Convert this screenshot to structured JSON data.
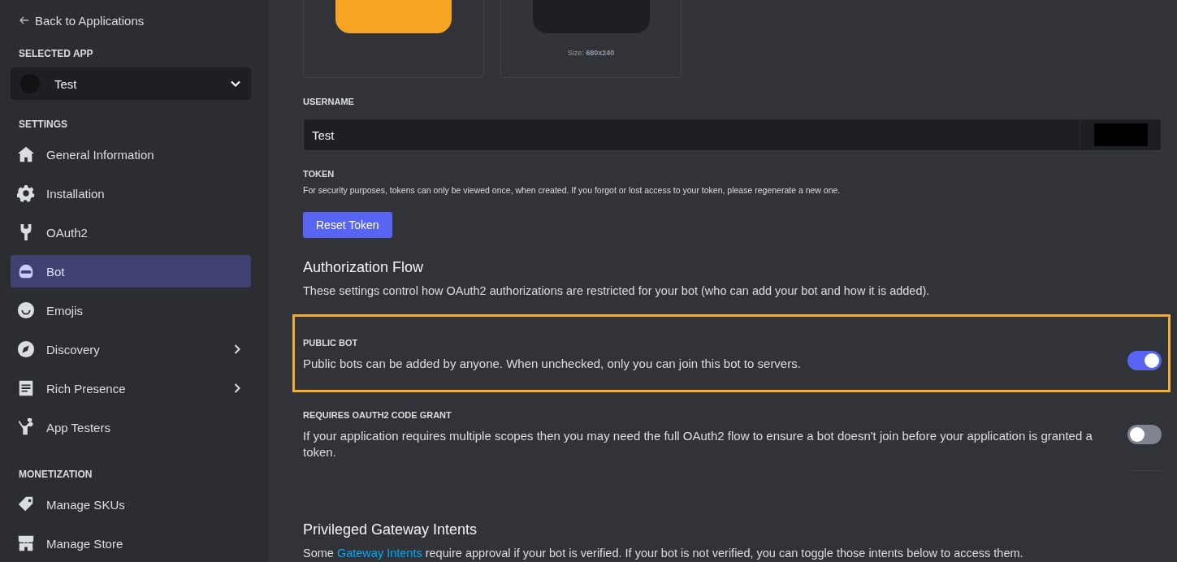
{
  "sidebar": {
    "back_link": "Back to Applications",
    "selected_app_label": "SELECTED APP",
    "selected_app": "Test",
    "sections": [
      {
        "title": "SETTINGS",
        "items": [
          {
            "label": "General Information",
            "selected": false,
            "has_submenu": false
          },
          {
            "label": "Installation",
            "selected": false,
            "has_submenu": false
          },
          {
            "label": "OAuth2",
            "selected": false,
            "has_submenu": false
          },
          {
            "label": "Bot",
            "selected": true,
            "has_submenu": false
          },
          {
            "label": "Emojis",
            "selected": false,
            "has_submenu": false
          },
          {
            "label": "Discovery",
            "selected": false,
            "has_submenu": true
          },
          {
            "label": "Rich Presence",
            "selected": false,
            "has_submenu": true
          },
          {
            "label": "App Testers",
            "selected": false,
            "has_submenu": false
          }
        ]
      },
      {
        "title": "MONETIZATION",
        "items": [
          {
            "label": "Manage SKUs",
            "selected": false,
            "has_submenu": false
          },
          {
            "label": "Manage Store",
            "selected": false,
            "has_submenu": false
          }
        ]
      }
    ]
  },
  "images": {
    "banner_size_label": "Size:",
    "banner_size": "680x240"
  },
  "username": {
    "label": "USERNAME",
    "value": "Test"
  },
  "token": {
    "label": "TOKEN",
    "description": "For security purposes, tokens can only be viewed once, when created. If you forgot or lost access to your token, please regenerate a new one.",
    "button": "Reset Token"
  },
  "authorization_flow": {
    "title": "Authorization Flow",
    "description": "These settings control how OAuth2 authorizations are restricted for your bot (who can add your bot and how it is added).",
    "settings": [
      {
        "label": "PUBLIC BOT",
        "description": "Public bots can be added by anyone. When unchecked, only you can join this bot to servers.",
        "on": true,
        "highlighted": true
      },
      {
        "label": "REQUIRES OAUTH2 CODE GRANT",
        "description": "If your application requires multiple scopes then you may need the full OAuth2 flow to ensure a bot doesn't join before your application is granted a token.",
        "on": false,
        "highlighted": false
      }
    ]
  },
  "privileged_intents": {
    "title": "Privileged Gateway Intents",
    "description_before": "Some ",
    "link": "Gateway Intents",
    "description_after": " require approval if your bot is verified. If your bot is not verified, you can toggle those intents below to access them."
  }
}
